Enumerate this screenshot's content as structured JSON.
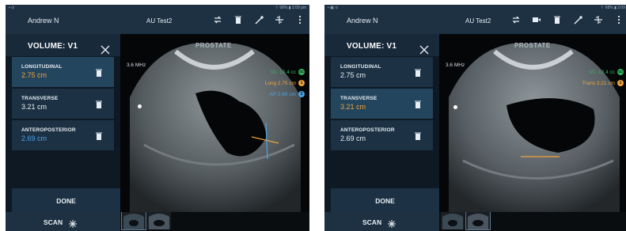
{
  "colors": {
    "orange": "#f0a23a",
    "blue": "#4aa3e6",
    "green": "#34b45a",
    "white": "#e8eef3"
  },
  "panels": [
    {
      "status": {
        "left": "▪ ⊙",
        "right": "⌔ 68% ▮ 2:09 pm"
      },
      "header": {
        "user": "Andrew N",
        "patient": "AU Test2",
        "tools": [
          "swap-icon",
          "trash-icon",
          "ruler-icon",
          "annotate-icon",
          "more-icon"
        ]
      },
      "volume": {
        "title": "VOLUME: V1"
      },
      "measurements": [
        {
          "label": "LONGITUDINAL",
          "value": "2.75 cm",
          "color": "#f0a23a",
          "selected": true
        },
        {
          "label": "TRANSVERSE",
          "value": "3.21 cm",
          "color": "#e8eef3",
          "selected": false
        },
        {
          "label": "ANTEROPOSTERIOR",
          "value": "2.69 cm",
          "color": "#4aa3e6",
          "selected": false
        }
      ],
      "done": "DONE",
      "scan": "SCAN",
      "image": {
        "title": "PROSTATE",
        "freq": "3.6 MHz",
        "readouts": [
          {
            "text": "V1: 12.4 cc",
            "color": "#34b45a",
            "badge": "cc"
          },
          {
            "text": "Long 2.75 cm",
            "color": "#f0a23a",
            "badge": "1"
          },
          {
            "text": "AP 2.69 cm",
            "color": "#4aa3e6",
            "badge": "2"
          }
        ]
      }
    },
    {
      "status": {
        "left": "▪ ▣ ⊙",
        "right": "⌔ 68% ▮ 2:09"
      },
      "header": {
        "user": "Andrew N",
        "patient": "AU Test2",
        "tools": [
          "swap-icon",
          "video-icon",
          "trash-icon",
          "ruler-icon",
          "annotate-icon",
          "more-icon"
        ]
      },
      "volume": {
        "title": "VOLUME: V1"
      },
      "measurements": [
        {
          "label": "LONGITUDINAL",
          "value": "2.75 cm",
          "color": "#e8eef3",
          "selected": false
        },
        {
          "label": "TRANSVERSE",
          "value": "3.21 cm",
          "color": "#f0a23a",
          "selected": true
        },
        {
          "label": "ANTEROPOSTERIOR",
          "value": "2.69 cm",
          "color": "#e8eef3",
          "selected": false
        }
      ],
      "done": "DONE",
      "scan": "SCAN",
      "image": {
        "title": "PROSTATE",
        "freq": "3.6 MHz",
        "readouts": [
          {
            "text": "V1: 12.4 cc",
            "color": "#34b45a",
            "badge": "cc"
          },
          {
            "text": "Trans 3.21 cm",
            "color": "#f0a23a",
            "badge": "1"
          }
        ]
      }
    }
  ]
}
